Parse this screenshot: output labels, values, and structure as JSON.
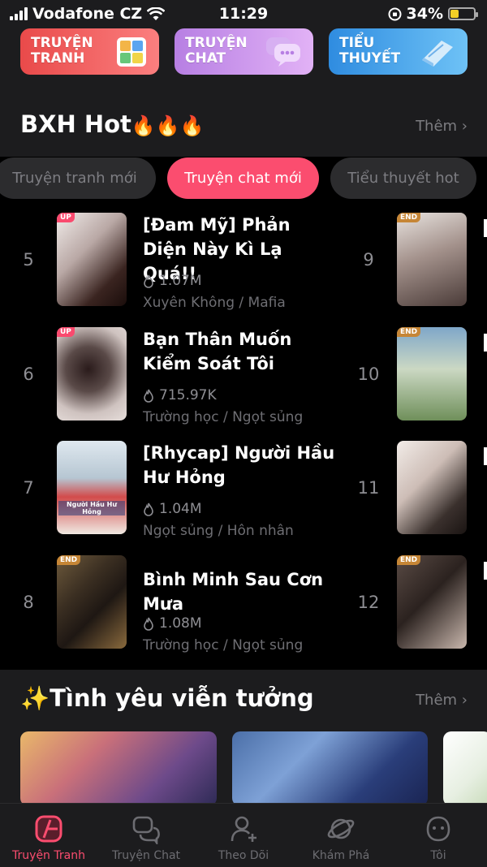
{
  "status": {
    "carrier": "Vodafone CZ",
    "time": "11:29",
    "battery": "34%",
    "battery_level": 0.34
  },
  "categories": [
    {
      "label": "TRUYỆN TRANH",
      "icon": "comic-grid-icon"
    },
    {
      "label": "TRUYỆN CHAT",
      "icon": "chat-bubble-icon"
    },
    {
      "label": "TIỂU THUYẾT",
      "icon": "book-icon"
    }
  ],
  "ranking": {
    "title": "BXH Hot",
    "emoji": "🔥🔥🔥",
    "more": "Thêm",
    "tabs": [
      "Truyện tranh mới",
      "Truyện chat mới",
      "Tiểu thuyết hot"
    ],
    "active_tab": 1,
    "items": [
      {
        "rank": "5",
        "badge": "UP",
        "title": "[Đam Mỹ] Phản Diện Này Kì Lạ Quá!!",
        "views": "1.07M",
        "genre": "Xuyên Không / Mafia"
      },
      {
        "rank": "6",
        "badge": "UP",
        "title": "Bạn Thân Muốn Kiểm Soát Tôi",
        "views": "715.97K",
        "genre": "Trường học / Ngọt sủng"
      },
      {
        "rank": "7",
        "badge": "",
        "title": "[Rhycap] Người Hầu Hư Hỏng",
        "views": "1.04M",
        "genre": "Ngọt sủng / Hôn nhân",
        "cover_text": "Người Hầu Hư Hỏng"
      },
      {
        "rank": "8",
        "badge": "END",
        "title": "Bình Minh Sau Cơn Mưa",
        "views": "1.08M",
        "genre": "Trường học / Ngọt sủng"
      }
    ],
    "items_right": [
      {
        "rank": "9",
        "badge": "END"
      },
      {
        "rank": "10",
        "badge": "END"
      },
      {
        "rank": "11",
        "badge": ""
      },
      {
        "rank": "12",
        "badge": "END"
      }
    ]
  },
  "fantasy": {
    "title": "✨Tình yêu viễn tưởng",
    "more": "Thêm"
  },
  "nav": [
    {
      "label": "Truyện Tranh",
      "icon": "comic-tab-icon",
      "active": true
    },
    {
      "label": "Truyện Chat",
      "icon": "chat-tab-icon",
      "active": false
    },
    {
      "label": "Theo Dõi",
      "icon": "follow-icon",
      "active": false
    },
    {
      "label": "Khám Phá",
      "icon": "planet-icon",
      "active": false
    },
    {
      "label": "Tôi",
      "icon": "profile-face-icon",
      "active": false
    }
  ],
  "colors": {
    "accent": "#fb4d6f",
    "background": "#1c1c1e",
    "ranking_bg": "#000000"
  }
}
